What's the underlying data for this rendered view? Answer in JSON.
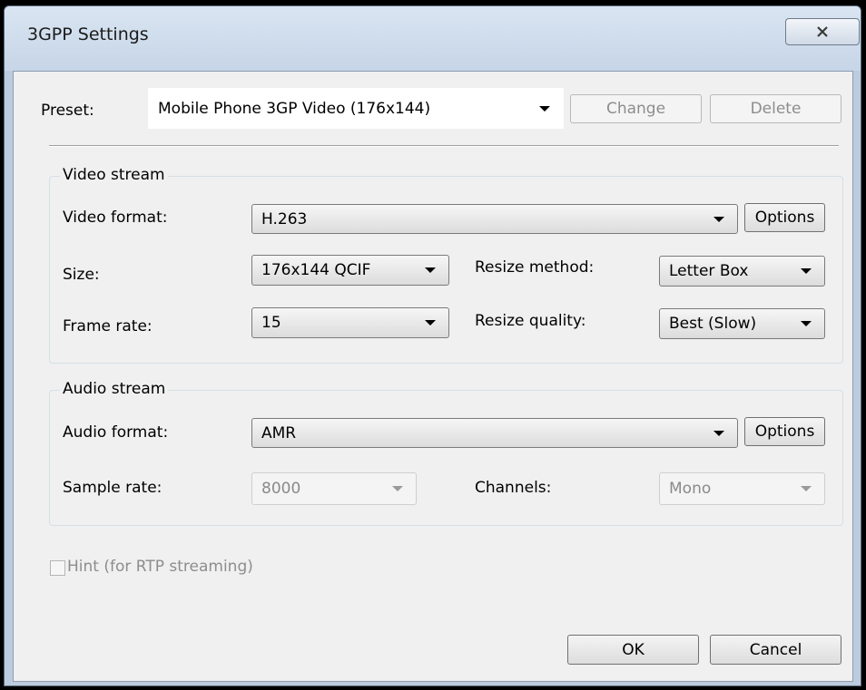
{
  "window": {
    "title": "3GPP Settings"
  },
  "preset": {
    "label": "Preset:",
    "value": "Mobile Phone 3GP Video (176x144)",
    "change_label": "Change",
    "delete_label": "Delete"
  },
  "video": {
    "group_label": "Video stream",
    "format_label": "Video format:",
    "format_value": "H.263",
    "options_label": "Options",
    "size_label": "Size:",
    "size_value": "176x144 QCIF",
    "resize_method_label": "Resize method:",
    "resize_method_value": "Letter Box",
    "frame_rate_label": "Frame rate:",
    "frame_rate_value": "15",
    "resize_quality_label": "Resize quality:",
    "resize_quality_value": "Best (Slow)"
  },
  "audio": {
    "group_label": "Audio stream",
    "format_label": "Audio format:",
    "format_value": "AMR",
    "options_label": "Options",
    "sample_rate_label": "Sample rate:",
    "sample_rate_value": "8000",
    "channels_label": "Channels:",
    "channels_value": "Mono"
  },
  "hint": {
    "label": "Hint (for RTP streaming)",
    "checked": false
  },
  "footer": {
    "ok_label": "OK",
    "cancel_label": "Cancel"
  },
  "icons": {
    "close": "close-icon",
    "dropdown": "chevron-down-icon"
  }
}
